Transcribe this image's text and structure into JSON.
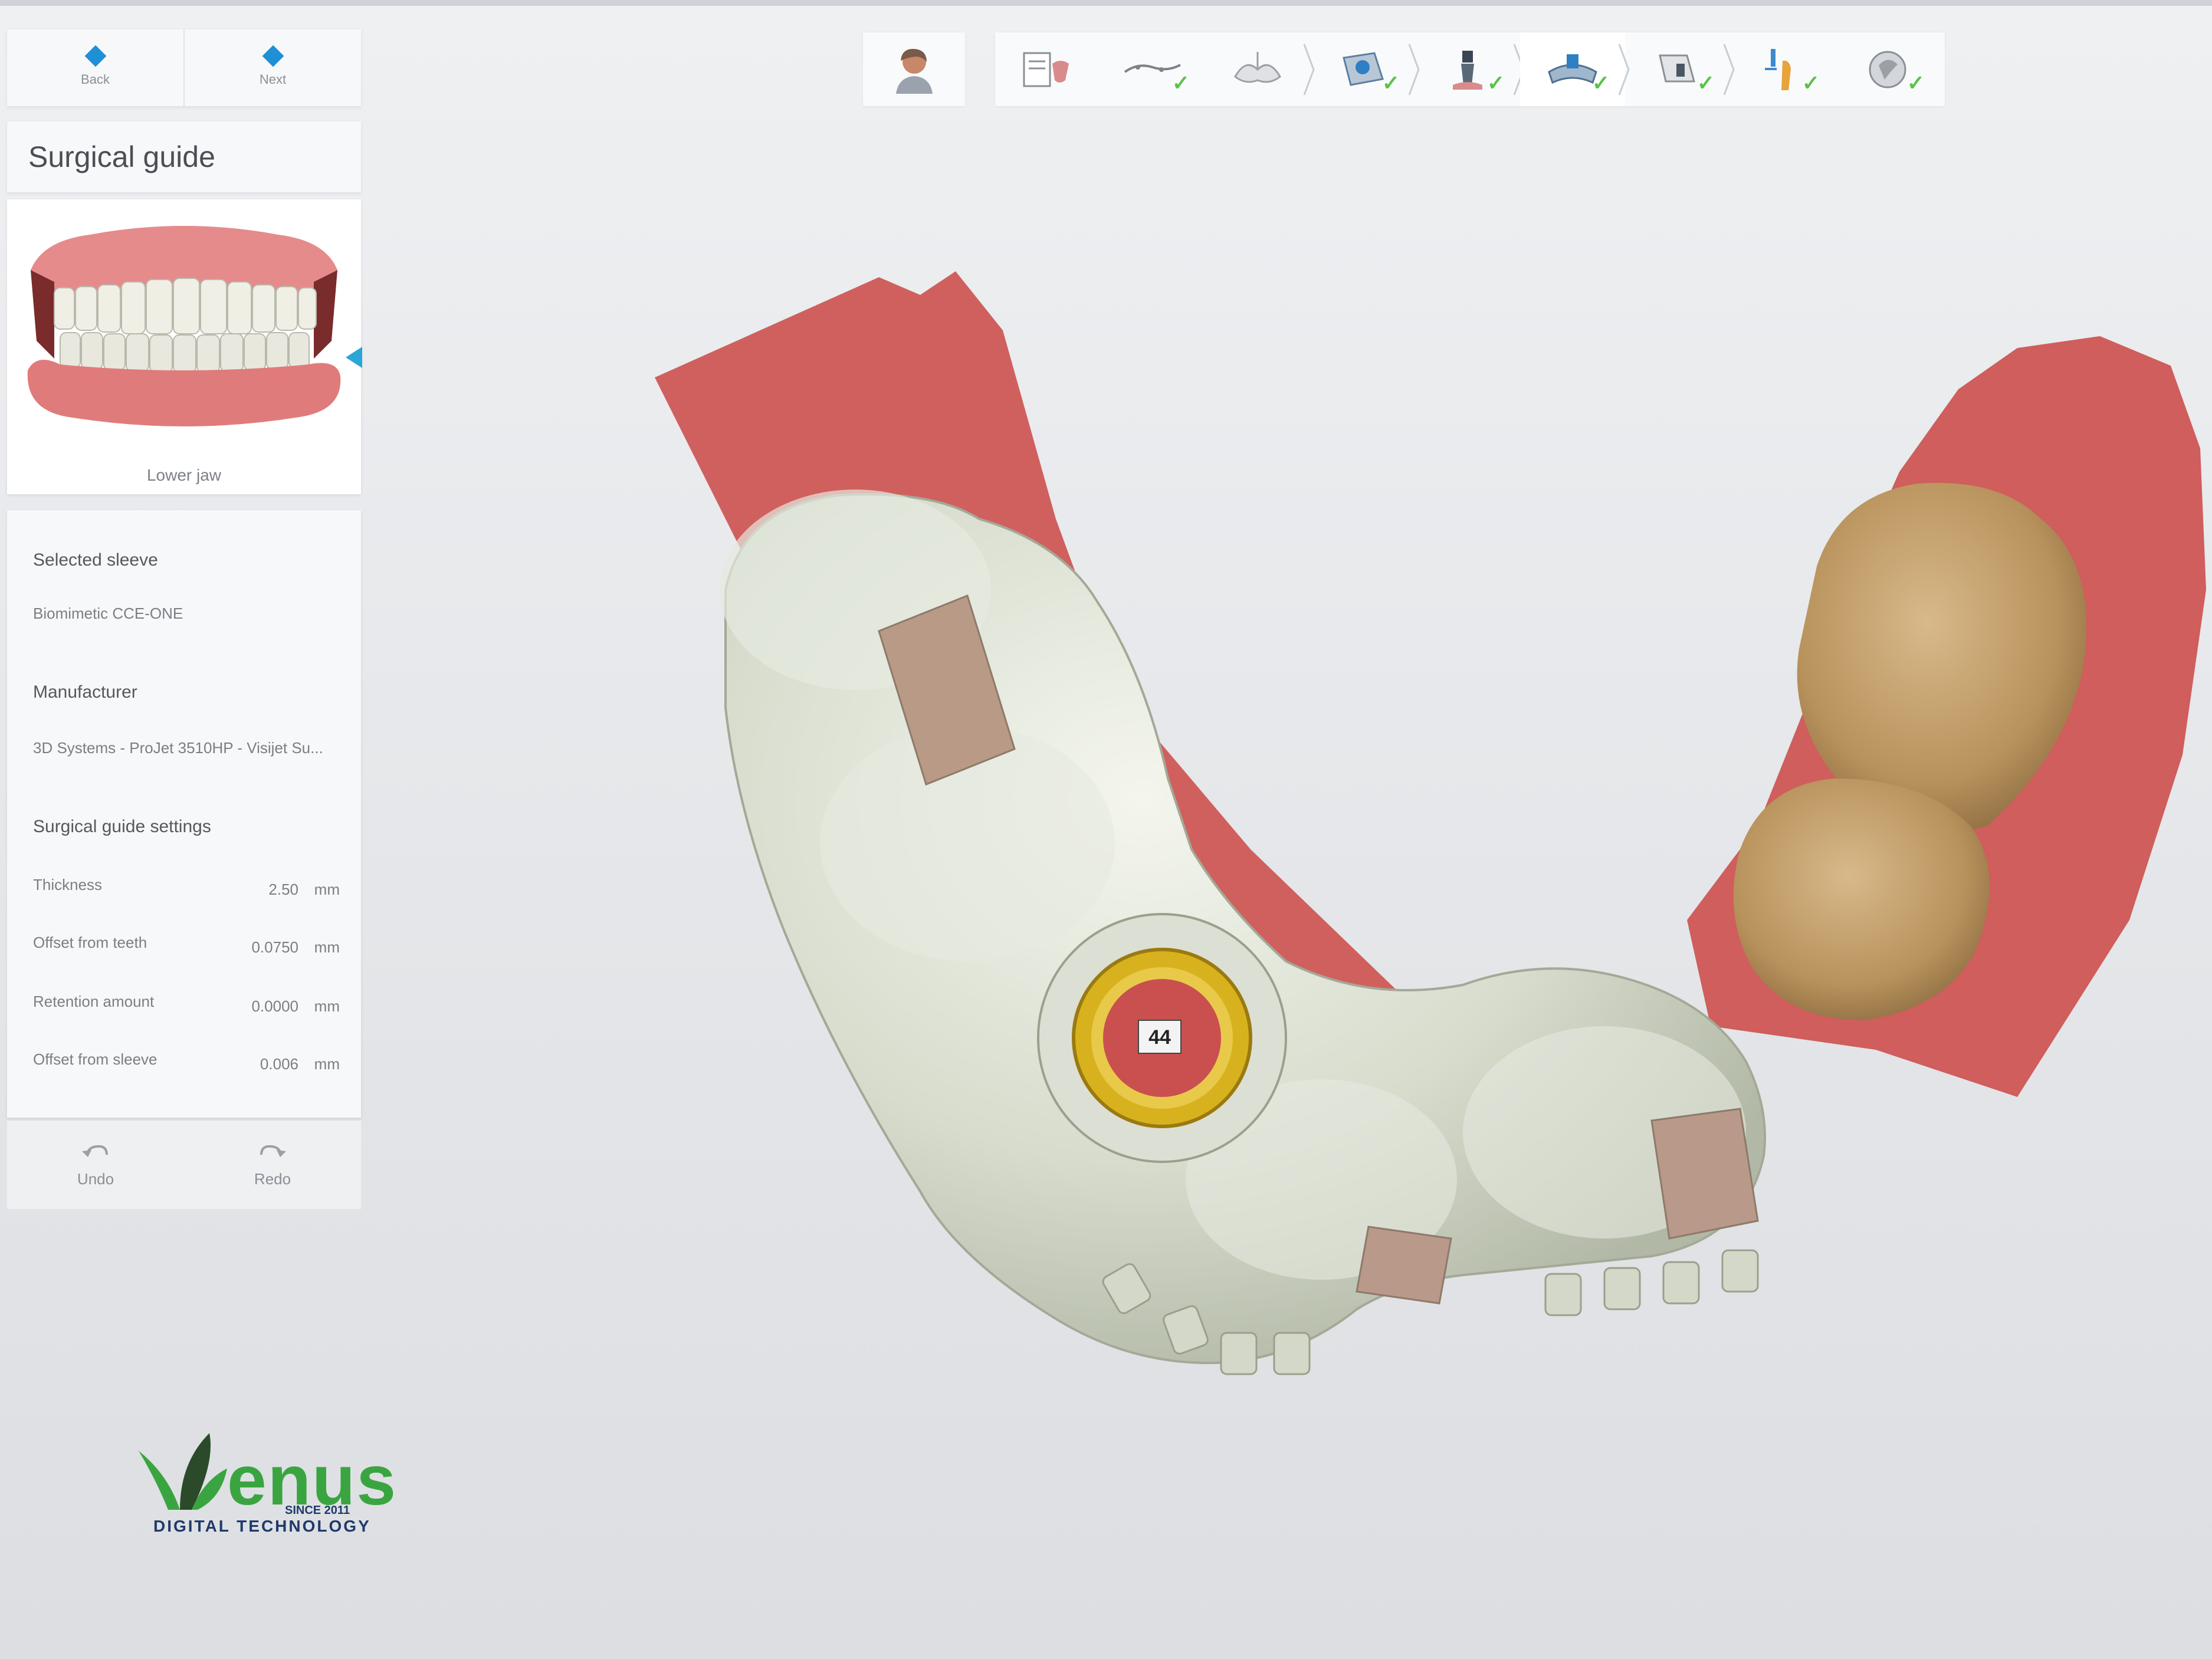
{
  "nav": {
    "back_label": "Back",
    "next_label": "Next"
  },
  "panel": {
    "title": "Surgical guide",
    "jaw_label": "Lower jaw",
    "selected_sleeve_label": "Selected sleeve",
    "selected_sleeve_value": "Biomimetic CCE-ONE",
    "manufacturer_label": "Manufacturer",
    "manufacturer_value": "3D Systems - ProJet 3510HP - Visijet Su...",
    "settings_label": "Surgical guide settings",
    "settings": [
      {
        "label": "Thickness",
        "value": "2.50",
        "unit": "mm"
      },
      {
        "label": "Offset from teeth",
        "value": "0.0750",
        "unit": "mm"
      },
      {
        "label": "Retention amount",
        "value": "0.0000",
        "unit": "mm"
      },
      {
        "label": "Offset from sleeve",
        "value": "0.006",
        "unit": "mm"
      }
    ]
  },
  "history": {
    "undo_label": "Undo",
    "redo_label": "Redo"
  },
  "toolbar": {
    "patient_icon": "patient-icon",
    "steps": [
      {
        "icon": "admin-icon",
        "completed": false
      },
      {
        "icon": "scan-icon",
        "completed": true
      },
      {
        "icon": "model-icon",
        "completed": false
      },
      {
        "icon": "import-icon",
        "completed": true
      },
      {
        "icon": "implant-icon",
        "completed": true
      },
      {
        "icon": "surgical-guide-icon",
        "completed": true,
        "active": true
      },
      {
        "icon": "sleeve-icon",
        "completed": true
      },
      {
        "icon": "drill-icon",
        "completed": true
      },
      {
        "icon": "export-icon",
        "completed": true
      }
    ]
  },
  "viewport": {
    "implant_label": "44"
  },
  "logo": {
    "word": "enus",
    "since": "SINCE 2011",
    "subtitle": "DIGITAL TECHNOLOGY"
  },
  "colors": {
    "accent": "#1f8fd6",
    "check": "#5ac24a",
    "gum": "#d36a6a",
    "guide": "#d9ddd0",
    "sleeve": "#d9b21e",
    "logo_green": "#3aa540",
    "logo_navy": "#1f3a6b"
  }
}
